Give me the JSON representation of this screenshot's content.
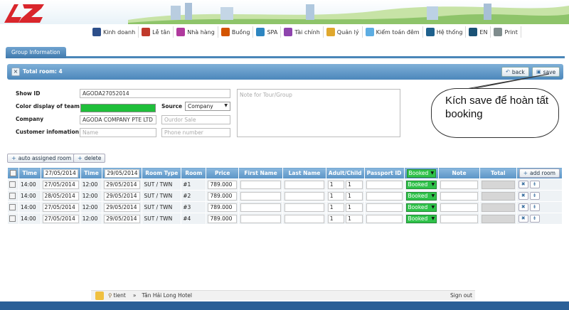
{
  "menu": [
    {
      "label": "Kinh doanh",
      "icon": "business-icon",
      "color": "#2d4f8a"
    },
    {
      "label": "Lễ tân",
      "icon": "reception-icon",
      "color": "#c0392b"
    },
    {
      "label": "Nhà hàng",
      "icon": "restaurant-icon",
      "color": "#b03a9e"
    },
    {
      "label": "Buồng",
      "icon": "housekeeping-icon",
      "color": "#d35400"
    },
    {
      "label": "SPA",
      "icon": "spa-icon",
      "color": "#2e86c1"
    },
    {
      "label": "Tài chính",
      "icon": "finance-icon",
      "color": "#8e44ad"
    },
    {
      "label": "Quản lý",
      "icon": "manage-icon",
      "color": "#e0a82e"
    },
    {
      "label": "Kiểm toán đêm",
      "icon": "night-audit-icon",
      "color": "#5dade2"
    },
    {
      "label": "Hệ thống",
      "icon": "system-icon",
      "color": "#1f618d"
    },
    {
      "label": "EN",
      "icon": "language-icon",
      "color": "#1a5276"
    },
    {
      "label": "Print",
      "icon": "print-icon",
      "color": "#7f8c8d"
    }
  ],
  "tab": {
    "label": "Group Information"
  },
  "bar": {
    "title": "Total room: 4",
    "back_label": "back",
    "save_label": "save"
  },
  "form": {
    "show_id_label": "Show ID",
    "show_id_value": "AGODA27052014",
    "color_label": "Color display of team",
    "color_value": "#1fbf3a",
    "source_label": "Source",
    "source_value": "Company",
    "company_label": "Company",
    "company_value": "AGODA COMPANY PTE LTD",
    "sale_placeholder": "Ourdor Sale",
    "customer_label": "Customer infomation",
    "name_placeholder": "Name",
    "phone_placeholder": "Phone number",
    "note_placeholder": "Note for Tour/Group"
  },
  "callout": {
    "text": "Kích save để hoàn tất booking"
  },
  "actions": {
    "auto_assigned_label": "auto assigned room",
    "delete_label": "delete"
  },
  "table": {
    "header": {
      "time1": "Time",
      "date1": "27/05/2014",
      "time2": "Time",
      "date2": "29/05/2014",
      "room_type": "Room Type",
      "room": "Room",
      "price": "Price",
      "first_name": "First Name",
      "last_name": "Last Name",
      "adult_child": "Adult/Child",
      "passport": "Passport ID",
      "status": "Booked",
      "note": "Note",
      "total": "Total",
      "add_room": "add room"
    },
    "rows": [
      {
        "time_in": "14:00",
        "date_in": "27/05/2014",
        "time_out": "12:00",
        "date_out": "29/05/2014",
        "room_type": "SUT / TWN",
        "room": "#1",
        "price": "789.000",
        "adult": "1",
        "child": "1",
        "status": "Booked"
      },
      {
        "time_in": "14:00",
        "date_in": "28/05/2014",
        "time_out": "12:00",
        "date_out": "29/05/2014",
        "room_type": "SUT / TWN",
        "room": "#2",
        "price": "789.000",
        "adult": "1",
        "child": "1",
        "status": "Booked"
      },
      {
        "time_in": "14:00",
        "date_in": "27/05/2014",
        "time_out": "12:00",
        "date_out": "29/05/2014",
        "room_type": "SUT / TWN",
        "room": "#3",
        "price": "789.000",
        "adult": "1",
        "child": "1",
        "status": "Booked"
      },
      {
        "time_in": "14:00",
        "date_in": "27/05/2014",
        "time_out": "12:00",
        "date_out": "29/05/2014",
        "room_type": "SUT / TWN",
        "room": "#4",
        "price": "789.000",
        "adult": "1",
        "child": "1",
        "status": "Booked"
      }
    ]
  },
  "footer": {
    "user": "tient",
    "hotel": "Tân Hải Long Hotel",
    "sign_out": "Sign out"
  }
}
